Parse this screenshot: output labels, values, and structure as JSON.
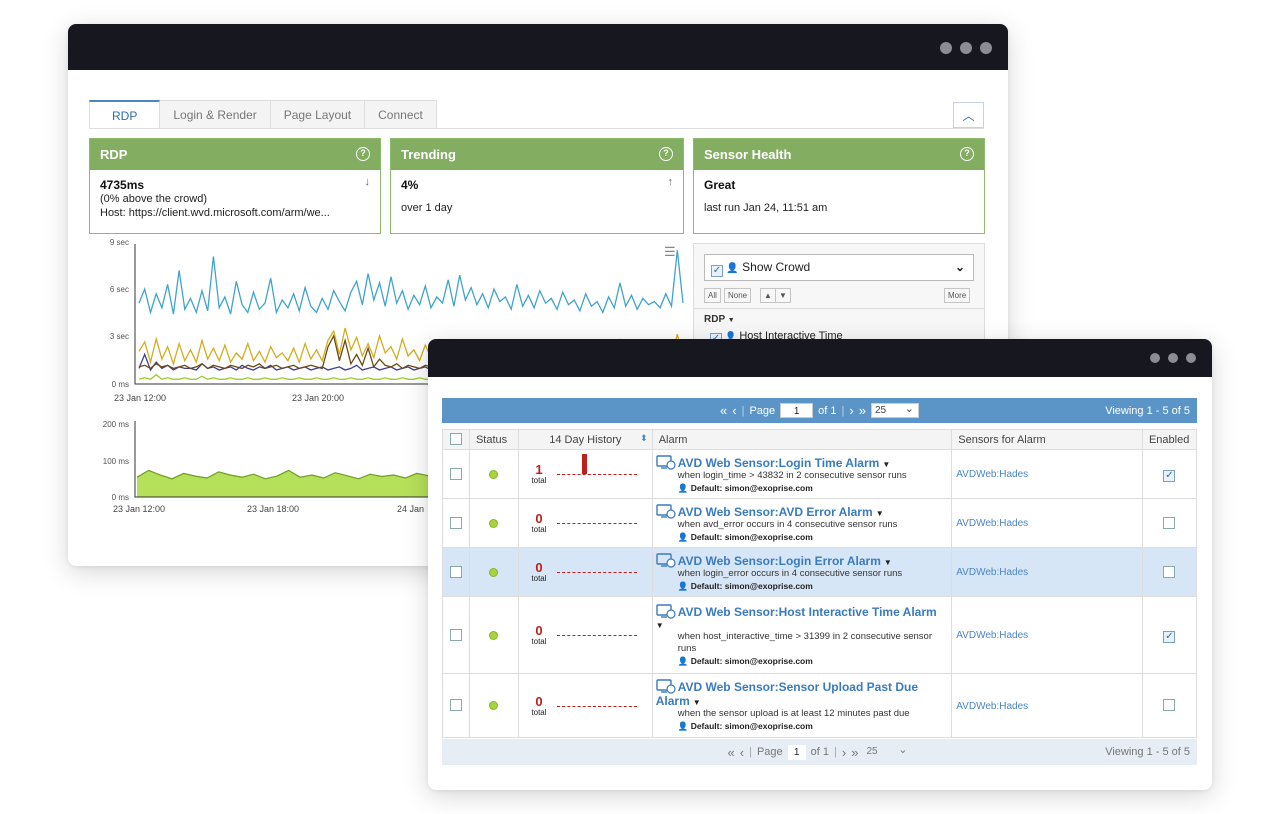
{
  "back_window": {
    "tabs": [
      "RDP",
      "Login & Render",
      "Page Layout",
      "Connect"
    ],
    "cards": [
      {
        "title": "RDP",
        "value": "4735ms",
        "arrow": "↓",
        "line1": "(0% above the crowd)",
        "line2": "Host: https://client.wvd.microsoft.com/arm/we..."
      },
      {
        "title": "Trending",
        "value": "4%",
        "arrow": "↑",
        "line1": "over 1 day",
        "line2": ""
      },
      {
        "title": "Sensor Health",
        "value": "Great",
        "arrow": "",
        "line1": "last run Jan 24, 11:51 am",
        "line2": ""
      }
    ],
    "legend": {
      "show_crowd": "Show Crowd",
      "all": "All",
      "none": "None",
      "more": "More",
      "group": "RDP",
      "item": "Host Interactive Time"
    }
  },
  "chart_data": [
    {
      "type": "line",
      "title": "",
      "y_ticks": [
        "9 sec",
        "6 sec",
        "3 sec",
        "0 ms"
      ],
      "x_ticks": [
        "23 Jan 12:00",
        "23 Jan 20:00"
      ],
      "ylim": [
        0,
        9
      ],
      "series": [
        {
          "color": "#3fa3cf",
          "values": [
            5.2,
            6.1,
            4.6,
            5.8,
            4.9,
            6.4,
            4.5,
            7.3,
            4.8,
            5.5,
            4.6,
            6.0,
            4.7,
            8.2,
            4.9,
            5.6,
            4.5,
            6.6,
            5.1,
            4.6,
            5.9,
            4.8,
            5.2,
            6.8,
            4.6,
            5.4,
            4.9,
            5.8,
            4.7,
            6.2,
            5.0,
            4.6,
            5.5,
            4.8,
            6.0,
            5.3,
            4.7,
            5.9,
            6.6,
            5.1,
            7.1,
            5.4,
            6.5,
            5.0,
            6.9,
            5.2,
            6.0,
            4.8,
            5.7,
            5.1,
            6.3,
            4.9,
            5.6,
            5.2,
            6.7,
            5.0,
            7.0,
            5.4,
            6.2,
            5.1,
            5.8,
            4.9,
            6.1,
            5.3,
            5.6,
            4.8,
            6.4,
            5.0,
            5.7,
            4.9,
            6.0,
            5.2,
            5.5,
            4.8,
            5.9,
            5.1,
            5.4,
            4.7,
            5.8,
            5.0,
            5.3,
            4.6,
            5.6,
            4.9,
            6.5,
            5.0,
            5.7,
            4.8,
            5.5,
            5.1,
            5.3,
            4.9,
            5.8,
            5.0,
            8.6,
            5.2
          ]
        },
        {
          "color": "#d4ac1e",
          "values": [
            2.1,
            2.7,
            1.4,
            2.9,
            1.6,
            2.4,
            1.3,
            2.6,
            1.5,
            2.2,
            1.4,
            2.8,
            1.6,
            2.3,
            1.5,
            2.5,
            1.4,
            2.0,
            1.6,
            2.6,
            1.5,
            2.1,
            1.4,
            2.4,
            1.7,
            2.0,
            1.5,
            2.3,
            1.4,
            2.6,
            1.6,
            2.2,
            1.5,
            2.8,
            3.4,
            1.9,
            3.6,
            2.2,
            3.0,
            1.8,
            2.6,
            1.7,
            3.1,
            2.0,
            2.4,
            1.6,
            2.9,
            1.8,
            2.2,
            1.5,
            2.5,
            1.7,
            2.1,
            1.6,
            2.4,
            1.5,
            2.2,
            1.7,
            2.6,
            1.6,
            2.3,
            1.5,
            2.7,
            1.6,
            2.1,
            1.5,
            2.4,
            1.6,
            2.2,
            1.5,
            2.5,
            1.6,
            2.0,
            1.5,
            2.3,
            1.7,
            2.1,
            1.6,
            2.6,
            1.5,
            2.2,
            1.6,
            2.4,
            1.5,
            2.8,
            1.6,
            2.1,
            1.5,
            2.5,
            1.6,
            2.3,
            1.5,
            2.7,
            1.6,
            3.2,
            1.8
          ]
        },
        {
          "color": "#6b4a13",
          "values": [
            1.1,
            1.2,
            1.0,
            1.3,
            1.1,
            1.2,
            1.0,
            1.1,
            1.2,
            1.0,
            1.1,
            1.3,
            1.0,
            1.2,
            1.1,
            1.0,
            1.2,
            1.1,
            1.0,
            1.2,
            1.1,
            1.3,
            1.0,
            1.1,
            1.2,
            1.0,
            1.1,
            1.2,
            1.0,
            1.1,
            1.2,
            1.1,
            1.0,
            2.4,
            3.1,
            1.5,
            2.8,
            1.3,
            1.9,
            1.2,
            2.3,
            1.1,
            1.6,
            1.2,
            1.1,
            1.3,
            1.0,
            1.2,
            1.1,
            1.0,
            1.2,
            1.1,
            1.3,
            1.0,
            1.1,
            1.2,
            1.0,
            1.1,
            1.2,
            1.0,
            1.1,
            1.3,
            1.0,
            1.2,
            1.1,
            1.0,
            1.2,
            1.1,
            1.3,
            1.0,
            1.1,
            1.2,
            1.0,
            1.1,
            1.2,
            1.0,
            1.1,
            1.3,
            1.0,
            1.2,
            1.1,
            1.0,
            1.2,
            1.1,
            1.0,
            1.2,
            1.1,
            1.3,
            1.0,
            1.1,
            1.2,
            1.0,
            1.1,
            1.2,
            1.4,
            1.1
          ]
        },
        {
          "color": "#3e3f94",
          "values": [
            1.0,
            1.9,
            0.9,
            1.4,
            1.0,
            1.2,
            0.9,
            1.1,
            1.0,
            1.0,
            0.9,
            1.3,
            1.0,
            1.1,
            0.9,
            1.0,
            1.1,
            0.9,
            1.2,
            1.0,
            0.9,
            1.1,
            1.0,
            1.2,
            0.9,
            1.0,
            1.1,
            0.9,
            1.0,
            1.1,
            0.9,
            1.0,
            1.1,
            0.9,
            1.0,
            1.1,
            0.9,
            1.0,
            1.2,
            0.9,
            1.0,
            1.1,
            0.9,
            1.0,
            1.1,
            0.9,
            1.0,
            1.1,
            0.9,
            1.0,
            1.1,
            0.9,
            1.0,
            1.1,
            0.9,
            1.0,
            1.1,
            0.9,
            1.0,
            1.1,
            0.9,
            1.0,
            1.1,
            0.9,
            1.0,
            1.1,
            0.9,
            1.0,
            1.1,
            0.9,
            1.0,
            1.1,
            0.9,
            1.0,
            1.1,
            0.9,
            1.0,
            1.1,
            0.9,
            1.0,
            1.1,
            0.9,
            1.0,
            1.1,
            0.9,
            1.0,
            1.1,
            0.9,
            1.0,
            1.1,
            0.9,
            1.0,
            1.1,
            0.9,
            1.0,
            1.1
          ]
        },
        {
          "color": "#9acd32",
          "values": [
            0.3,
            0.4,
            0.3,
            0.6,
            0.3,
            0.4,
            0.3,
            0.3,
            0.4,
            0.3,
            0.3,
            0.5,
            0.3,
            0.4,
            0.3,
            0.3,
            0.4,
            0.3,
            0.3,
            0.4,
            0.3,
            0.3,
            0.4,
            0.3,
            0.3,
            0.4,
            0.3,
            0.3,
            0.4,
            0.3,
            0.3,
            0.4,
            0.3,
            0.3,
            0.4,
            0.3,
            0.3,
            0.4,
            0.3,
            0.3,
            0.4,
            0.3,
            0.3,
            0.4,
            0.3,
            0.3,
            0.4,
            0.3,
            0.3,
            0.4,
            0.3,
            0.3,
            0.4,
            0.3,
            0.3,
            0.4,
            0.3,
            0.3,
            0.4,
            0.3,
            0.3,
            0.4,
            0.3,
            0.3,
            0.4,
            0.3,
            0.3,
            0.4,
            0.3,
            0.3,
            0.4,
            0.3,
            0.3,
            0.4,
            0.3,
            0.3,
            0.4,
            0.3,
            0.3,
            0.4,
            0.3,
            0.3,
            0.4,
            0.3,
            0.3,
            0.4,
            0.3,
            0.3,
            0.4,
            0.3,
            0.3,
            0.4,
            0.3,
            0.3,
            0.4,
            0.3
          ]
        }
      ]
    },
    {
      "type": "area",
      "title": "",
      "y_ticks": [
        "200 ms",
        "100 ms",
        "0 ms"
      ],
      "x_ticks": [
        "23 Jan 12:00",
        "23 Jan 18:00",
        "24 Jan"
      ],
      "ylim": [
        0,
        200
      ],
      "series": [
        {
          "color": "#9ad03a",
          "values": [
            52,
            70,
            58,
            48,
            62,
            55,
            50,
            66,
            58,
            52,
            60,
            48,
            55,
            70,
            52,
            58,
            50,
            64,
            56,
            48,
            60,
            54,
            58,
            50,
            62,
            56,
            60,
            125,
            65,
            55,
            50,
            62,
            58,
            52,
            66,
            55,
            48,
            60,
            54,
            58,
            50,
            62,
            55,
            50,
            58,
            52,
            56,
            60
          ]
        }
      ]
    }
  ],
  "pager": {
    "page_label": "Page",
    "page": "1",
    "of": "of 1",
    "per_page": "25",
    "viewing": "Viewing 1 - 5 of 5"
  },
  "table": {
    "headers": [
      "Status",
      "14 Day History",
      "Alarm",
      "Sensors for Alarm",
      "Enabled"
    ],
    "total_label": "total",
    "rows": [
      {
        "count": "1",
        "title": "AVD Web Sensor:Login Time Alarm",
        "desc": "when login_time > 43832 in 2 consecutive sensor runs",
        "default": "Default: simon@exoprise.com",
        "sensor": "AVDWeb:Hades",
        "enabled": true,
        "selected": false,
        "spike": true
      },
      {
        "count": "0",
        "title": "AVD Web Sensor:AVD Error Alarm",
        "desc": "when avd_error occurs in 4 consecutive sensor runs",
        "default": "Default: simon@exoprise.com",
        "sensor": "AVDWeb:Hades",
        "enabled": false,
        "selected": false,
        "spike": false
      },
      {
        "count": "0",
        "title": "AVD Web Sensor:Login Error Alarm",
        "desc": "when login_error occurs in 4 consecutive sensor runs",
        "default": "Default: simon@exoprise.com",
        "sensor": "AVDWeb:Hades",
        "enabled": false,
        "selected": true,
        "spike": false
      },
      {
        "count": "0",
        "title": "AVD Web Sensor:Host Interactive Time Alarm",
        "desc": "when host_interactive_time > 31399 in 2 consecutive sensor runs",
        "default": "Default: simon@exoprise.com",
        "sensor": "AVDWeb:Hades",
        "enabled": true,
        "selected": false,
        "spike": false
      },
      {
        "count": "0",
        "title": "AVD Web Sensor:Sensor Upload Past Due Alarm",
        "desc": "when the sensor upload is at least 12 minutes past due",
        "default": "Default: simon@exoprise.com",
        "sensor": "AVDWeb:Hades",
        "enabled": false,
        "selected": false,
        "spike": false
      }
    ]
  }
}
